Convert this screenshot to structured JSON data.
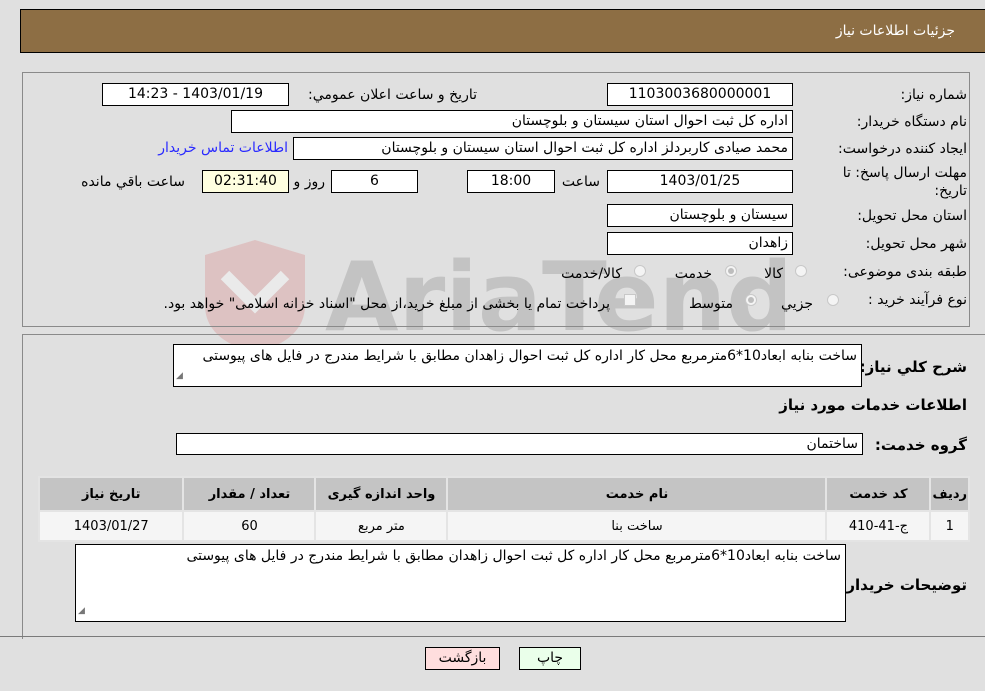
{
  "header": {
    "title": "جزئیات اطلاعات نیاز"
  },
  "fields": {
    "need_number_label": "شماره نیاز:",
    "need_number": "1103003680000001",
    "announce_label": "تاریخ و ساعت اعلان عمومي:",
    "announce_value": "1403/01/19 - 14:23",
    "buyer_org_label": "نام دستگاه خریدار:",
    "buyer_org": "اداره کل ثبت احوال استان سیستان و بلوچستان",
    "creator_label": "ایجاد کننده درخواست:",
    "creator": "محمد صیادی کاربردلز اداره کل ثبت احوال استان سیستان و بلوچستان",
    "contact_link": "اطلاعات تماس خریدار",
    "deadline_label": "مهلت ارسال پاسخ: تا تاریخ:",
    "deadline_date": "1403/01/25",
    "time_label": "ساعت",
    "deadline_time": "18:00",
    "days_value": "6",
    "days_label": "روز و",
    "remaining_time": "02:31:40",
    "remaining_label": "ساعت باقي مانده",
    "province_label": "استان محل تحویل:",
    "province": "سیستان و بلوچستان",
    "city_label": "شهر محل تحویل:",
    "city": "زاهدان",
    "category_label": "طبقه بندی موضوعی:",
    "category_options": [
      {
        "label": "کالا",
        "selected": false
      },
      {
        "label": "خدمت",
        "selected": true
      },
      {
        "label": "کالا/خدمت",
        "selected": false
      }
    ],
    "process_label": "نوع فرآیند خرید :",
    "process_options": [
      {
        "label": "جزيي",
        "selected": false
      },
      {
        "label": "متوسط",
        "selected": true
      }
    ],
    "treasury_note": "پرداخت تمام یا بخشی از مبلغ خرید،از محل \"اسناد خزانه اسلامی\" خواهد بود.",
    "treasury_checked": false
  },
  "summary": {
    "label": "شرح کلي نیاز:",
    "value": "ساخت بنابه ابعاد10*6مترمربع محل کار اداره کل ثبت احوال زاهدان مطابق با شرایط مندرج در فایل های پیوستی"
  },
  "services": {
    "section_title": "اطلاعات خدمات مورد نیاز",
    "group_label": "گروه خدمت:",
    "group_value": "ساختمان",
    "columns": [
      "ردیف",
      "کد خدمت",
      "نام خدمت",
      "واحد اندازه گیری",
      "تعداد / مقدار",
      "تاریخ نیاز"
    ],
    "rows": [
      [
        "1",
        "ج-41-410",
        "ساخت بنا",
        "متر مربع",
        "60",
        "1403/01/27"
      ]
    ]
  },
  "buyer_notes": {
    "label": "توضیحات خریدار:",
    "value": "ساخت بنابه ابعاد10*6مترمربع محل کار اداره کل ثبت احوال زاهدان مطابق با شرایط مندرج در فایل های پیوستی"
  },
  "buttons": {
    "print": "چاپ",
    "back": "بازگشت"
  },
  "colors": {
    "header": "#8d6e44",
    "print_bg": "#eaffea",
    "back_bg": "#ffdede",
    "link": "#2a2aff"
  }
}
